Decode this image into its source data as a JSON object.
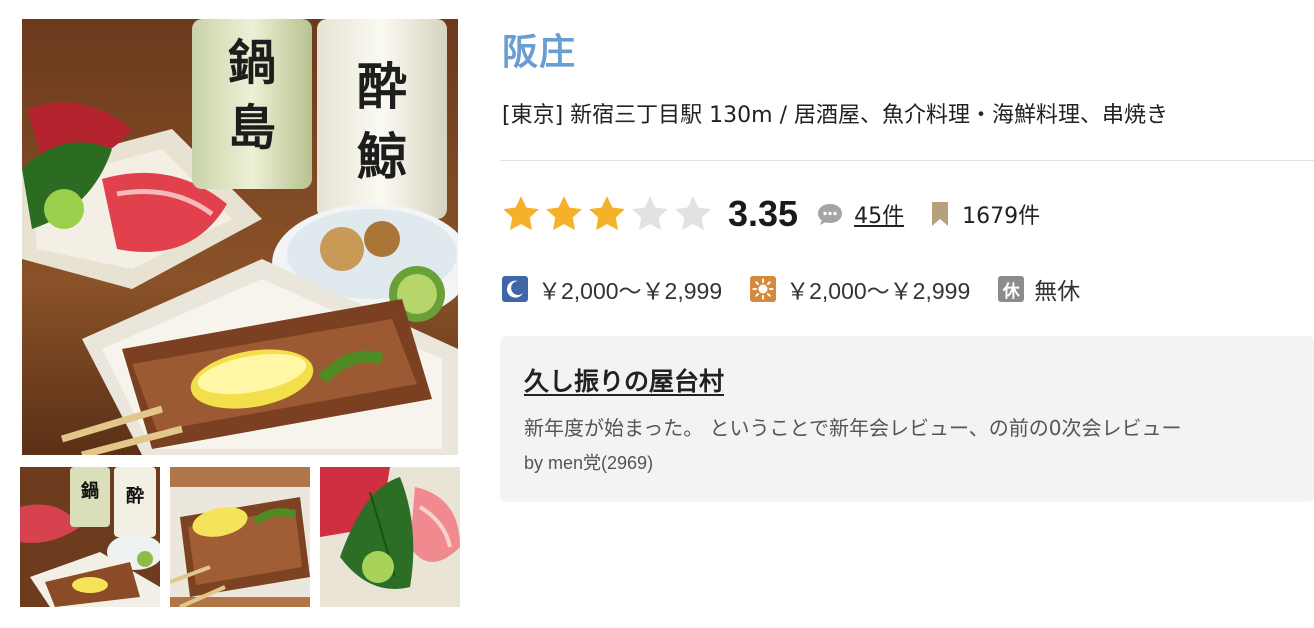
{
  "shop": {
    "name": "阪庄",
    "meta": "[東京] 新宿三丁目駅 130m / 居酒屋、魚介料理・海鮮料理、串焼き"
  },
  "rating": {
    "value": "3.35",
    "stars_filled": 3,
    "stars_total": 5,
    "star_color": "#f5b12a",
    "star_empty_color": "#e2e2e2",
    "reviews_label": "45件",
    "bookmarks_label": "1679件"
  },
  "price": {
    "dinner": "￥2,000～￥2,999",
    "lunch": "￥2,000～￥2,999",
    "holiday_badge": "休",
    "holiday": "無休",
    "dinner_icon": "moon-icon",
    "lunch_icon": "sun-icon"
  },
  "review": {
    "title": "久し振りの屋台村",
    "excerpt": "新年度が始まった。 ということで新年会レビュー、の前の0次会レビュー",
    "author": "by men党(2969)"
  },
  "photos": {
    "main_image": "sake bottles, sashimi and yakitori",
    "thumbnails": [
      "sake and dishes",
      "yakitori skewers",
      "sashimi with shiso leaf"
    ],
    "bottle_labels": [
      "鍋島",
      "酔鯨"
    ]
  },
  "colors": {
    "title": "#6a9dd1",
    "moon_icon": "#3f67a8",
    "sun_icon": "#d5893a",
    "bookmark_icon": "#b4a27e",
    "card_bg": "#f4f3f1"
  }
}
